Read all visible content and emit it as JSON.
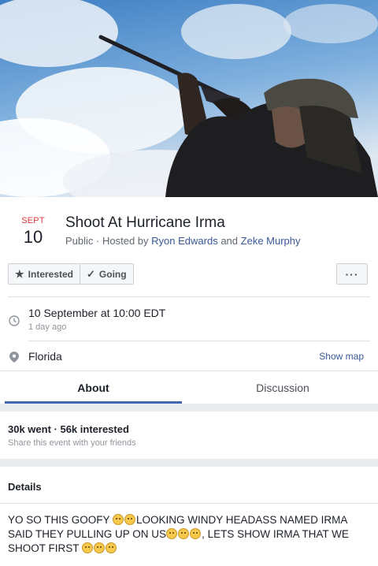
{
  "event": {
    "month": "SEPT",
    "day": "10",
    "title": "Shoot At Hurricane Irma",
    "visibility": "Public",
    "hosted_by_prefix": "· Hosted by",
    "host1": "Ryon Edwards",
    "and": "and",
    "host2": "Zeke Murphy"
  },
  "actions": {
    "interested": "Interested",
    "going": "Going",
    "more": "···"
  },
  "time": {
    "main": "10 September at 10:00 EDT",
    "sub": "1 day ago"
  },
  "location": {
    "name": "Florida",
    "show_map": "Show map"
  },
  "tabs": [
    {
      "label": "About"
    },
    {
      "label": "Discussion"
    }
  ],
  "stats": {
    "summary": "30k went · 56k interested",
    "share": "Share this event with your friends"
  },
  "details": {
    "heading": "Details",
    "text_part1": "YO SO THIS GOOFY ",
    "text_part2": "LOOKING WINDY HEADASS NAMED IRMA SAID THEY PULLING UP ON US",
    "text_part3": ", LETS SHOW IRMA THAT WE SHOOT FIRST "
  },
  "colors": {
    "accent": "#4267b2",
    "link": "#385898",
    "month": "#e0393e"
  }
}
